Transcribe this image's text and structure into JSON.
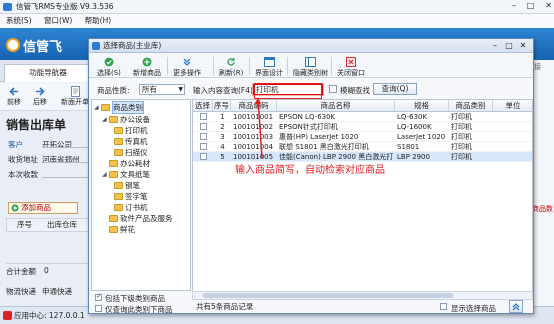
{
  "main_window": {
    "title": "信管飞RMS专业版 V9.3.536",
    "menu": [
      "系统(S)",
      "窗口(W)",
      "帮助(H)"
    ],
    "brand": "信管飞",
    "left_tab": "功能导航器",
    "toolbar": [
      "前移",
      "后移",
      "新面开单"
    ],
    "doc_title": "销售出库单",
    "fields": [
      {
        "label": "客户",
        "value": "开拓公司"
      },
      {
        "label": "收货地址",
        "value": "河南省郑州"
      },
      {
        "label": "本次收款",
        "value": ""
      }
    ],
    "add_product_button": "添加商品",
    "grid_headers": [
      "序号",
      "出库仓库"
    ],
    "total_label": "合计金额",
    "total_value": "0",
    "logistics_label": "物流快递",
    "logistics_value": "申通快递",
    "status_text": "应用中心: 127.0.0.1",
    "right_side_text": "接",
    "right_side_red": "商品数"
  },
  "dialog": {
    "title": "选择商品(主业库)",
    "toolbar": [
      {
        "label": "选择(S)",
        "icon": "check-circle-icon"
      },
      {
        "label": "新增商品",
        "icon": "add-icon"
      },
      {
        "label": "更多操作",
        "icon": "chevron-down-icon"
      },
      {
        "label": "刷新(R)",
        "icon": "refresh-icon"
      },
      {
        "label": "界面设计",
        "icon": "design-icon"
      },
      {
        "label": "隐藏类别树",
        "icon": "tree-icon"
      },
      {
        "label": "关闭窗口",
        "icon": "close-window-icon"
      }
    ],
    "filter": {
      "category_label": "商品性质:",
      "category_value": "所有",
      "search_label": "输入内容查询(F4):",
      "search_value": "打印机",
      "fuzzy_label": "模糊查找",
      "query_button": "查询(Q)"
    },
    "tree": {
      "root": "商品类别",
      "nodes": [
        {
          "label": "办公设备",
          "level": 1,
          "expanded": true
        },
        {
          "label": "打印机",
          "level": 2
        },
        {
          "label": "传真机",
          "level": 2
        },
        {
          "label": "扫描仪",
          "level": 2
        },
        {
          "label": "办公耗材",
          "level": 1
        },
        {
          "label": "文具纸笔",
          "level": 1,
          "expanded": true
        },
        {
          "label": "钢笔",
          "level": 2
        },
        {
          "label": "签字笔",
          "level": 2
        },
        {
          "label": "订书机",
          "level": 2
        },
        {
          "label": "软件产品及服务",
          "level": 1
        },
        {
          "label": "鲜花",
          "level": 1
        }
      ],
      "include_sub_label": "包括下级类别商品",
      "current_only_label": "仅查询此类别下商品"
    },
    "table": {
      "columns": [
        "选择",
        "序号",
        "商品编码",
        "商品名称",
        "规格",
        "商品类别",
        "单位"
      ],
      "rows": [
        {
          "no": "1",
          "code": "100101001",
          "name": "EPSON LQ-630K",
          "spec": "LQ-630K",
          "category": "打印机"
        },
        {
          "no": "2",
          "code": "100101002",
          "name": "EPSON针式打印机",
          "spec": "LQ-1600K",
          "category": "打印机"
        },
        {
          "no": "3",
          "code": "100101003",
          "name": "惠普(HP) LaserJet 1020",
          "spec": "LaserJet 1020",
          "category": "打印机"
        },
        {
          "no": "4",
          "code": "100101004",
          "name": "联想 S1801 黑白激光打印机",
          "spec": "S1801",
          "category": "打印机"
        },
        {
          "no": "5",
          "code": "100101005",
          "name": "佳能(Canon) LBP 2900 黑白激光打",
          "spec": "LBP 2900",
          "category": "打印机"
        }
      ]
    },
    "status": "共有5条商品记录",
    "only_selected_label": "显示选择商品"
  },
  "annotation": "输入商品简写，自动检索对应商品",
  "colors": {
    "accent": "#1664b3",
    "annotation": "#e02020",
    "selected_row": "#d6e6fb"
  }
}
